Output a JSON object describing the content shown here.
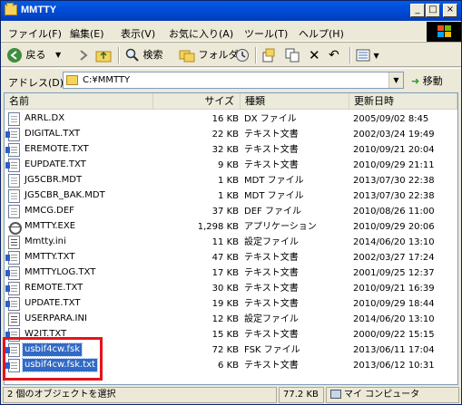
{
  "window": {
    "title": "MMTTY",
    "minimize_label": "_",
    "maximize_label": "□",
    "close_label": "×"
  },
  "menu": [
    {
      "label": "ファイル(F)"
    },
    {
      "label": "編集(E)"
    },
    {
      "label": "表示(V)"
    },
    {
      "label": "お気に入り(A)"
    },
    {
      "label": "ツール(T)"
    },
    {
      "label": "ヘルプ(H)"
    }
  ],
  "toolbar": {
    "back_label": "戻る",
    "search_label": "検索",
    "folders_label": "フォルダ"
  },
  "address": {
    "label": "アドレス(D)",
    "path": "C:¥MMTTY",
    "go_label": "移動"
  },
  "columns": {
    "name": "名前",
    "size": "サイズ",
    "type": "種類",
    "modified": "更新日時"
  },
  "files": [
    {
      "name": "ARRL.DX",
      "size": "16 KB",
      "type": "DX ファイル",
      "modified": "2005/09/02 8:45",
      "icon": "generic-file-icon",
      "selected": false
    },
    {
      "name": "DIGITAL.TXT",
      "size": "22 KB",
      "type": "テキスト文書",
      "modified": "2002/03/24 19:49",
      "icon": "notepad-icon",
      "selected": false
    },
    {
      "name": "EREMOTE.TXT",
      "size": "32 KB",
      "type": "テキスト文書",
      "modified": "2010/09/21 20:04",
      "icon": "notepad-icon",
      "selected": false
    },
    {
      "name": "EUPDATE.TXT",
      "size": "9 KB",
      "type": "テキスト文書",
      "modified": "2010/09/29 21:11",
      "icon": "notepad-icon",
      "selected": false
    },
    {
      "name": "JG5CBR.MDT",
      "size": "1 KB",
      "type": "MDT ファイル",
      "modified": "2013/07/30 22:38",
      "icon": "generic-file-icon",
      "selected": false
    },
    {
      "name": "JG5CBR_BAK.MDT",
      "size": "1 KB",
      "type": "MDT ファイル",
      "modified": "2013/07/30 22:38",
      "icon": "generic-file-icon",
      "selected": false
    },
    {
      "name": "MMCG.DEF",
      "size": "37 KB",
      "type": "DEF ファイル",
      "modified": "2010/08/26 11:00",
      "icon": "generic-file-icon",
      "selected": false
    },
    {
      "name": "MMTTY.EXE",
      "size": "1,298 KB",
      "type": "アプリケーション",
      "modified": "2010/09/29 20:06",
      "icon": "exe-icon",
      "selected": false
    },
    {
      "name": "Mmtty.ini",
      "size": "11 KB",
      "type": "設定ファイル",
      "modified": "2014/06/20 13:10",
      "icon": "ini-icon",
      "selected": false
    },
    {
      "name": "MMTTY.TXT",
      "size": "47 KB",
      "type": "テキスト文書",
      "modified": "2002/03/27 17:24",
      "icon": "notepad-icon",
      "selected": false
    },
    {
      "name": "MMTTYLOG.TXT",
      "size": "17 KB",
      "type": "テキスト文書",
      "modified": "2001/09/25 12:37",
      "icon": "notepad-icon",
      "selected": false
    },
    {
      "name": "REMOTE.TXT",
      "size": "30 KB",
      "type": "テキスト文書",
      "modified": "2010/09/21 16:39",
      "icon": "notepad-icon",
      "selected": false
    },
    {
      "name": "UPDATE.TXT",
      "size": "19 KB",
      "type": "テキスト文書",
      "modified": "2010/09/29 18:44",
      "icon": "notepad-icon",
      "selected": false
    },
    {
      "name": "USERPARA.INI",
      "size": "12 KB",
      "type": "設定ファイル",
      "modified": "2014/06/20 13:10",
      "icon": "ini-icon",
      "selected": false
    },
    {
      "name": "W2IT.TXT",
      "size": "15 KB",
      "type": "テキスト文書",
      "modified": "2000/09/22 15:15",
      "icon": "notepad-icon",
      "selected": false
    },
    {
      "name": "usbif4cw.fsk",
      "size": "72 KB",
      "type": "FSK ファイル",
      "modified": "2013/06/11 17:04",
      "icon": "notepad-icon",
      "selected": true
    },
    {
      "name": "usbif4cw.fsk.txt",
      "size": "6 KB",
      "type": "テキスト文書",
      "modified": "2013/06/12 10:31",
      "icon": "notepad-icon",
      "selected": true
    }
  ],
  "status": {
    "selection": "2 個のオブジェクトを選択",
    "size": "77.2 KB",
    "location": "マイ コンピュータ"
  },
  "colors": {
    "titlebar": "#0054e3",
    "selection": "#316ac5",
    "highlight_border": "#e8121a"
  }
}
